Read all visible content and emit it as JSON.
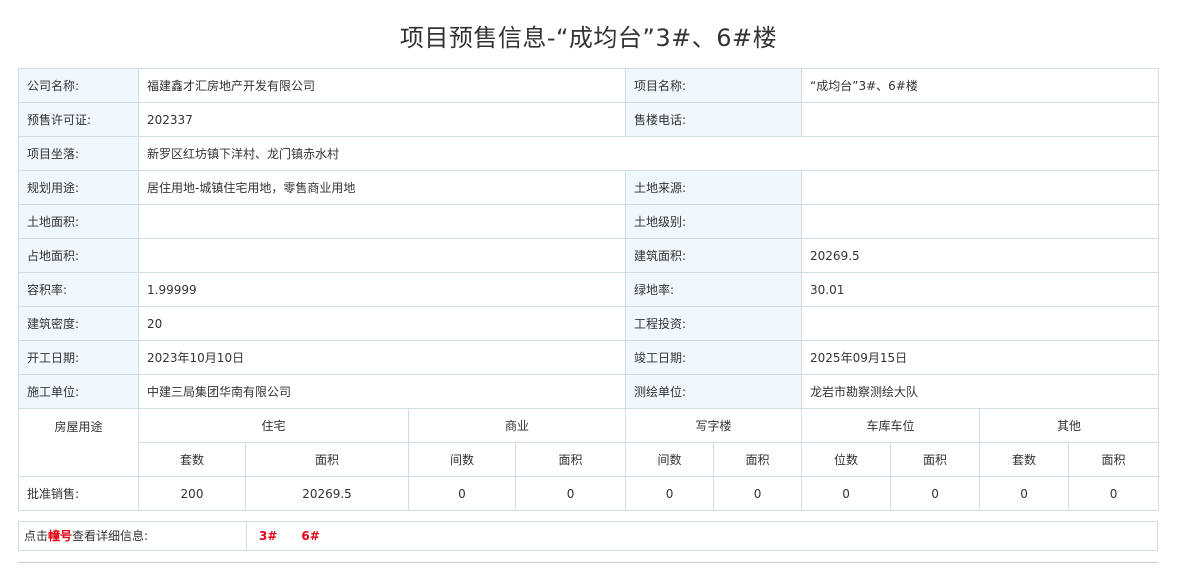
{
  "page": {
    "title": "项目预售信息-“成均台”3#、6#楼"
  },
  "info": {
    "company_label": "公司名称:",
    "company_value": "福建鑫才汇房地产开发有限公司",
    "project_label": "项目名称:",
    "project_value": "“成均台”3#、6#楼",
    "permit_label": "预售许可证:",
    "permit_value": "202337",
    "phone_label": "售楼电话:",
    "phone_value": "",
    "location_label": "项目坐落:",
    "location_value": "新罗区红坊镇下洋村、龙门镇赤水村",
    "usage_label": "规划用途:",
    "usage_value": "居住用地-城镇住宅用地，零售商业用地",
    "land_source_label": "土地来源:",
    "land_source_value": "",
    "land_area_label": "土地面积:",
    "land_area_value": "",
    "land_grade_label": "土地级别:",
    "land_grade_value": "",
    "occupied_area_label": "占地面积:",
    "occupied_area_value": "",
    "building_area_label": "建筑面积:",
    "building_area_value": "20269.5",
    "plot_ratio_label": "容积率:",
    "plot_ratio_value": "1.99999",
    "green_rate_label": "绿地率:",
    "green_rate_value": "30.01",
    "building_density_label": "建筑密度:",
    "building_density_value": "20",
    "investment_label": "工程投资:",
    "investment_value": "",
    "start_date_label": "开工日期:",
    "start_date_value": "2023年10月10日",
    "completion_date_label": "竣工日期:",
    "completion_date_value": "2025年09月15日",
    "construction_unit_label": "施工单位:",
    "construction_unit_value": "中建三局集团华南有限公司",
    "survey_unit_label": "测绘单位:",
    "survey_unit_value": "龙岩市勘察测绘大队"
  },
  "sales": {
    "usage_header": "房屋用途",
    "groups": [
      {
        "name": "住宅",
        "sub1": "套数",
        "sub2": "面积",
        "val1": "200",
        "val2": "20269.5"
      },
      {
        "name": "商业",
        "sub1": "间数",
        "sub2": "面积",
        "val1": "0",
        "val2": "0"
      },
      {
        "name": "写字楼",
        "sub1": "间数",
        "sub2": "面积",
        "val1": "0",
        "val2": "0"
      },
      {
        "name": "车库车位",
        "sub1": "位数",
        "sub2": "面积",
        "val1": "0",
        "val2": "0"
      },
      {
        "name": "其他",
        "sub1": "套数",
        "sub2": "面积",
        "val1": "0",
        "val2": "0"
      }
    ],
    "approved_label": "批准销售:"
  },
  "buildings_link": {
    "prefix": "点击",
    "highlight": "幢号",
    "suffix": "查看详细信息:",
    "items": [
      "3#",
      "6#"
    ]
  },
  "colors": {
    "border": "#cfdde8",
    "label_bg": "#f0f7fd",
    "link_red": "#e60012"
  }
}
